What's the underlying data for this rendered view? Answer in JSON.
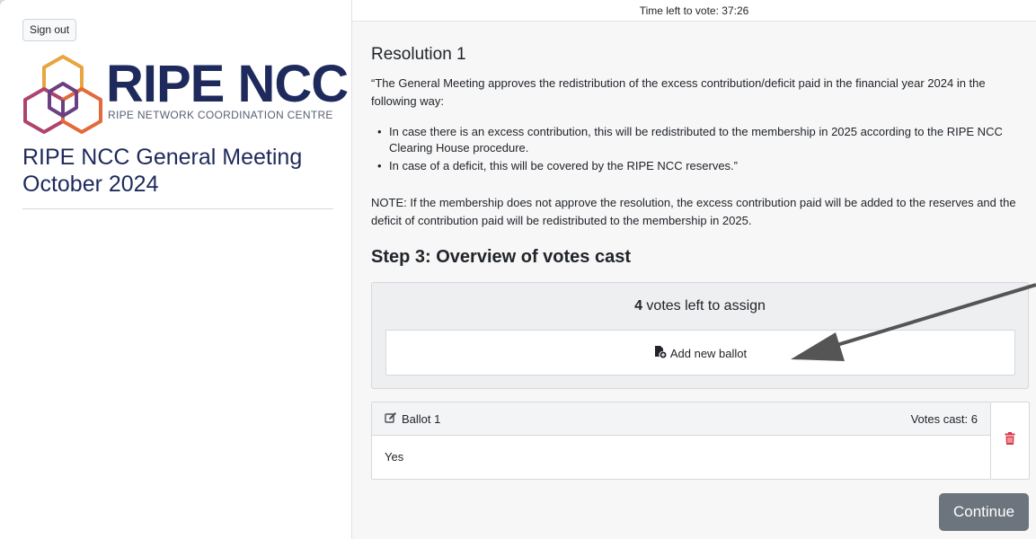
{
  "sidebar": {
    "signout_label": "Sign out",
    "logo": {
      "name": "RIPE NCC",
      "subtitle": "RIPE NETWORK COORDINATION CENTRE",
      "colors": [
        "#e8a540",
        "#e36a3a",
        "#b0436d",
        "#6a3f83",
        "#1f2a5c"
      ]
    },
    "meeting_title": "RIPE NCC General Meeting October 2024"
  },
  "main": {
    "timer": "Time left to vote: 37:26",
    "resolution": {
      "title": "Resolution 1",
      "text": "“The General Meeting approves the redistribution of the excess contribution/deficit paid in the financial year 2024 in the following way:",
      "bullets": [
        "In case there is an excess contribution, this will be redistributed to the membership in 2025 according to the RIPE NCC Clearing House procedure.",
        "In case of a deficit, this will be covered by the RIPE NCC reserves.”"
      ],
      "note": "NOTE: If the membership does not approve the resolution, the excess contribution paid will be added to the reserves and the deficit of contribution paid will be redistributed to the membership in 2025."
    },
    "step_title": "Step 3: Overview of votes cast",
    "votes_left": {
      "count": "4",
      "label": " votes left to assign"
    },
    "add_ballot_label": "Add new ballot",
    "ballots": [
      {
        "name": "Ballot 1",
        "votes_cast": "Votes cast: 6",
        "choice": "Yes",
        "delete_icon": "trash-icon",
        "delete_color": "#dc3545"
      }
    ],
    "continue_label": "Continue"
  },
  "annotation": {
    "type": "arrow",
    "color": "#555555"
  }
}
